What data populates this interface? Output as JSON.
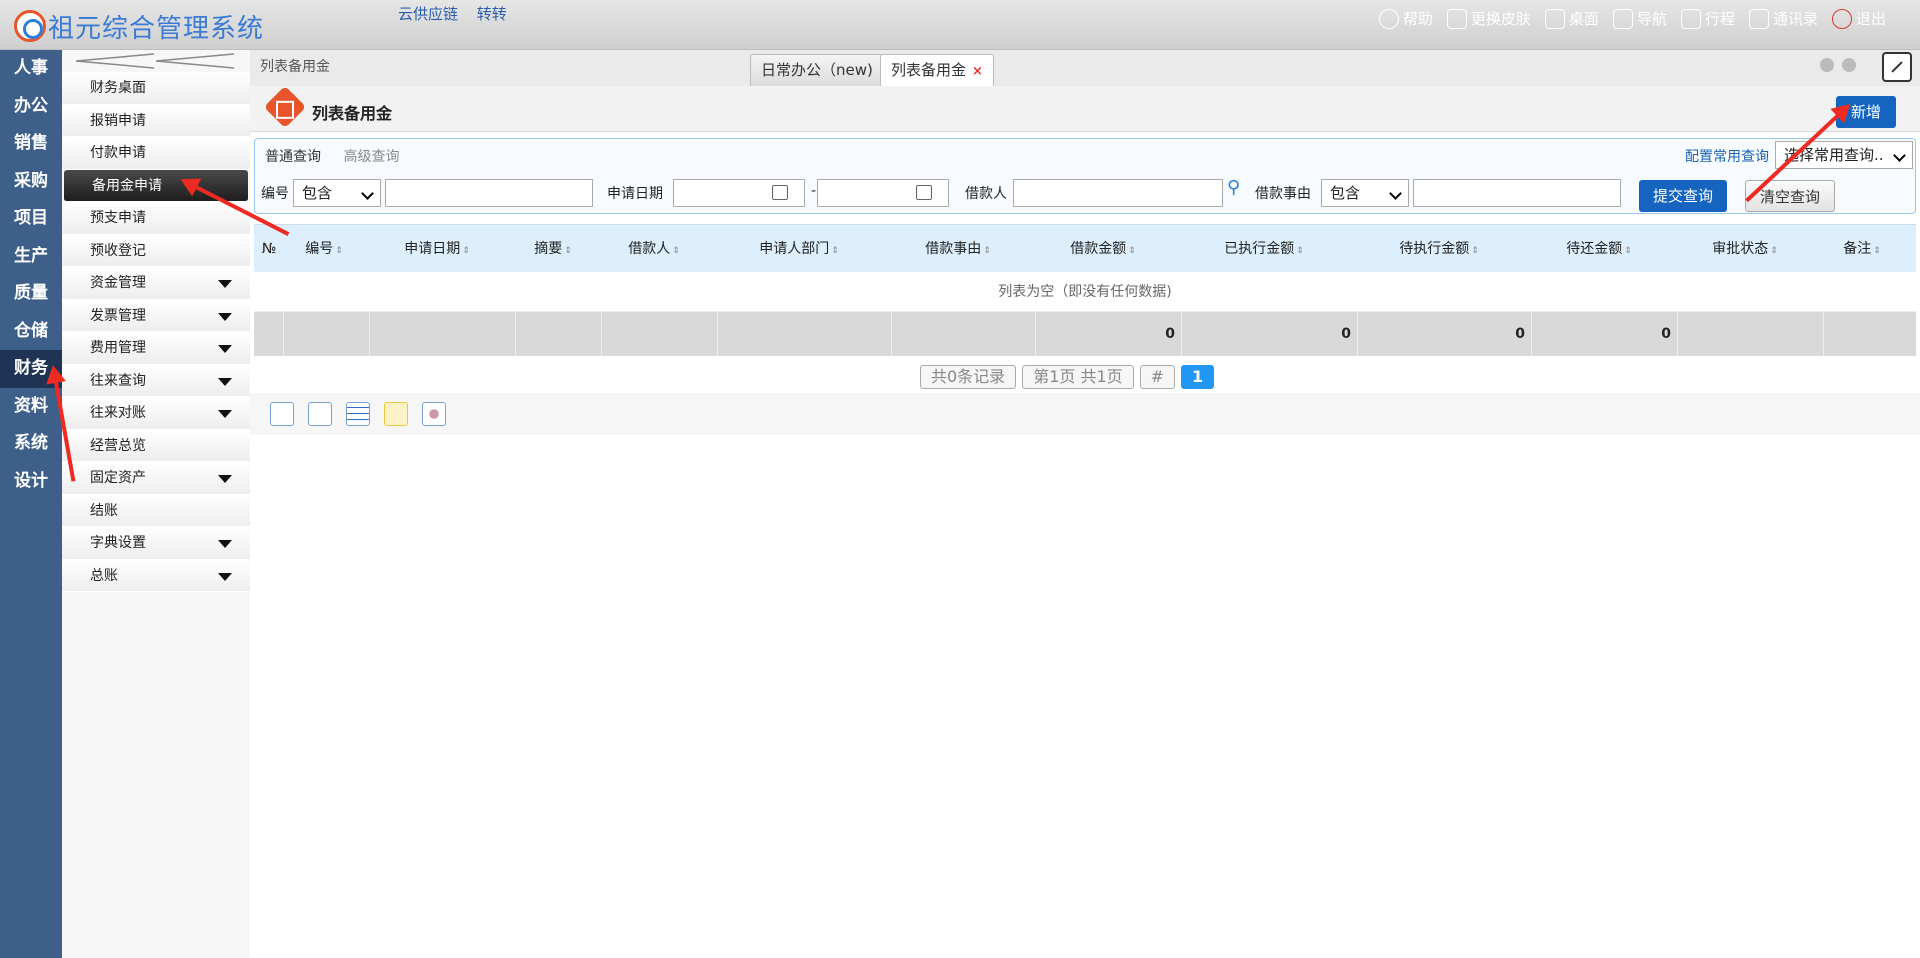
{
  "app": {
    "title": "祖元综合管理系统",
    "links": [
      "云供应链",
      "转转"
    ]
  },
  "topbar": {
    "items": [
      {
        "label": "帮助",
        "icon": "help-icon"
      },
      {
        "label": "更换皮肤",
        "icon": "shirt-icon"
      },
      {
        "label": "桌面",
        "icon": "home-icon"
      },
      {
        "label": "导航",
        "icon": "nav-grid-icon"
      },
      {
        "label": "行程",
        "icon": "calendar-icon"
      },
      {
        "label": "通讯录",
        "icon": "contacts-icon"
      },
      {
        "label": "退出",
        "icon": "power-icon"
      }
    ]
  },
  "leftnav": {
    "items": [
      "人事",
      "办公",
      "销售",
      "采购",
      "项目",
      "生产",
      "质量",
      "仓储",
      "财务",
      "资料",
      "系统",
      "设计"
    ],
    "active": "财务"
  },
  "submenu": {
    "items": [
      {
        "label": "财务桌面",
        "has_children": false
      },
      {
        "label": "报销申请",
        "has_children": false
      },
      {
        "label": "付款申请",
        "has_children": false
      },
      {
        "label": "备用金申请",
        "has_children": false,
        "active": true
      },
      {
        "label": "预支申请",
        "has_children": false
      },
      {
        "label": "预收登记",
        "has_children": false
      },
      {
        "label": "资金管理",
        "has_children": true
      },
      {
        "label": "发票管理",
        "has_children": true
      },
      {
        "label": "费用管理",
        "has_children": true
      },
      {
        "label": "往来查询",
        "has_children": true
      },
      {
        "label": "往来对账",
        "has_children": true
      },
      {
        "label": "经营总览",
        "has_children": false
      },
      {
        "label": "固定资产",
        "has_children": true
      },
      {
        "label": "结账",
        "has_children": false
      },
      {
        "label": "字典设置",
        "has_children": true
      },
      {
        "label": "总账",
        "has_children": true
      }
    ]
  },
  "breadcrumb": "列表备用金",
  "tabs": [
    {
      "label": "日常办公（new)"
    },
    {
      "label": "列表备用金",
      "closable": true,
      "active": true
    }
  ],
  "tab_close": "×",
  "page": {
    "title": "列表备用金",
    "add_label": "新增"
  },
  "query": {
    "tabs": [
      "普通查询",
      "高级查询"
    ],
    "config_label": "配置常用查询",
    "common_select": "选择常用查询..",
    "fields": {
      "code_label": "编号",
      "code_op": "包含",
      "date_label": "申请日期",
      "date_sep": "-",
      "borrower_label": "借款人",
      "reason_label": "借款事由",
      "reason_op": "包含"
    },
    "submit_label": "提交查询",
    "clear_label": "清空查询"
  },
  "table": {
    "columns": [
      "№",
      "编号",
      "申请日期",
      "摘要",
      "借款人",
      "申请人部门",
      "借款事由",
      "借款金额",
      "已执行金额",
      "待执行金额",
      "待还金额",
      "审批状态",
      "备注"
    ],
    "empty_text": "列表为空（即没有任何数据)",
    "totals": [
      "",
      "",
      "",
      "",
      "",
      "",
      "",
      "0",
      "0",
      "0",
      "0",
      "",
      ""
    ]
  },
  "pager": {
    "records": "共0条记录",
    "pages": "第1页 共1页",
    "hash": "#",
    "current": "1"
  },
  "colors": {
    "accent": "#1565c0",
    "nav_bg": "#3e5f8a",
    "nav_active": "#1f3354",
    "header_bg": "#ddeffc",
    "annotation": "#ee2b23"
  }
}
